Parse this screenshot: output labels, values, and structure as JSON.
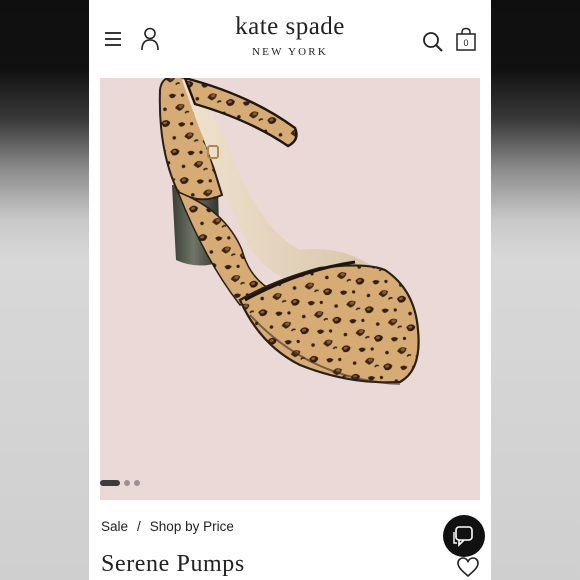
{
  "header": {
    "brand_name": "kate spade",
    "brand_sub": "NEW YORK",
    "bag_count": "0",
    "icons": [
      "menu-icon",
      "account-icon",
      "search-icon",
      "shopping-bag-icon"
    ]
  },
  "hero": {
    "image": "leopard-print-mary-jane-pump",
    "carousel": {
      "total": 3,
      "active": 1
    }
  },
  "breadcrumb": {
    "items": [
      "Sale",
      "Shop by Price"
    ],
    "separator": "/"
  },
  "product": {
    "title": "Serene Pumps"
  },
  "actions": {
    "chat_icon": "chat-icon",
    "wishlist_icon": "heart-icon"
  },
  "colors": {
    "hero_background": "#ead9d6",
    "text": "#222222",
    "chat_button": "#111111"
  }
}
